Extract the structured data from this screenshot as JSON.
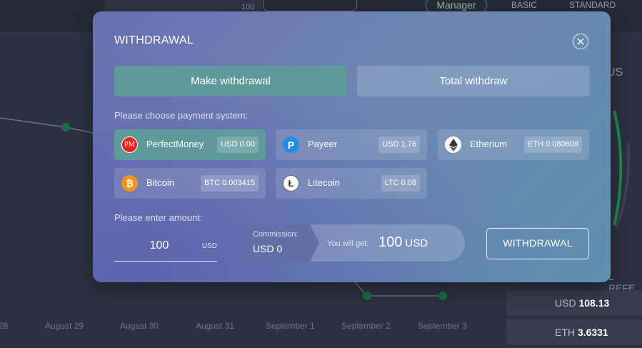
{
  "background": {
    "header_number": "100",
    "plan_button": "Manager",
    "plan_basic": "BASIC",
    "plan_standard": "STANDARD",
    "status_fragment": "US",
    "referral_fragment": "L REFE",
    "cards": [
      {
        "currency": "USD",
        "value": "108.13"
      },
      {
        "currency": "ETH",
        "value": "3.6331"
      }
    ],
    "axis_labels": [
      "28",
      "August 29",
      "August 30",
      "August 31",
      "September 1",
      "September 2",
      "September 3"
    ]
  },
  "modal": {
    "title": "WITHDRAWAL",
    "tabs": [
      {
        "label": "Make withdrawal",
        "active": true
      },
      {
        "label": "Total withdraw",
        "active": false
      }
    ],
    "choose_label": "Please choose payment system:",
    "payment_systems": [
      {
        "name": "PerfectMoney",
        "balance": "USD 0.00",
        "icon": "perfectmoney-icon",
        "icon_text": "PM",
        "active": true
      },
      {
        "name": "Payeer",
        "balance": "USD 1.76",
        "icon": "payeer-icon",
        "icon_text": "P",
        "active": false
      },
      {
        "name": "Etherium",
        "balance": "ETH 0.080609",
        "icon": "ethereum-icon",
        "active": false
      },
      {
        "name": "Bitcoin",
        "balance": "BTC 0.003415",
        "icon": "bitcoin-icon",
        "icon_text": "₿",
        "active": false
      },
      {
        "name": "Litecoin",
        "balance": "LTC 0.08",
        "icon": "litecoin-icon",
        "icon_text": "Ł",
        "active": false
      }
    ],
    "amount_label": "Please enter amount:",
    "amount_value": "100",
    "amount_unit": "USD",
    "commission_label": "Commission:",
    "commission_value": "USD 0",
    "you_get_label": "You will get:",
    "you_get_amount": "100",
    "you_get_currency": "USD",
    "submit_label": "WITHDRAWAL"
  },
  "colors": {
    "active_tab": "#5e9a9a",
    "perfectmoney_red": "#e8251c",
    "payeer_blue": "#1f8ee0",
    "bitcoin_orange": "#f7931a",
    "chart_green": "#1f8a4c"
  }
}
